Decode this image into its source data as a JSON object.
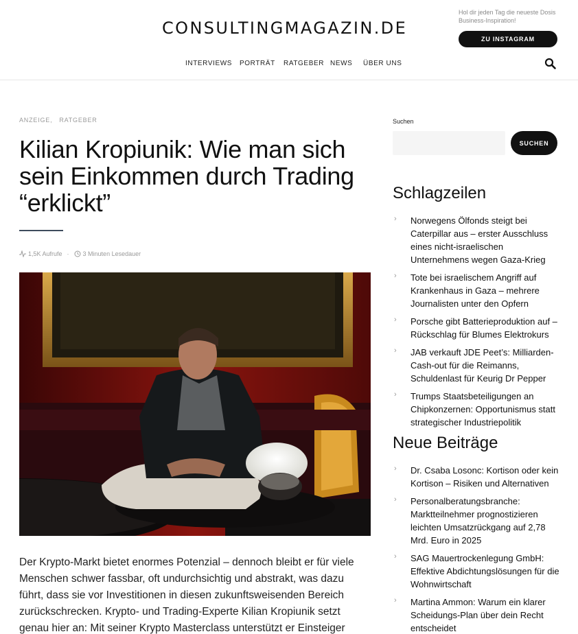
{
  "header": {
    "logo": "CONSULTINGMAGAZIN.DE",
    "promo_text": "Hol dir jeden Tag die neueste Dosis Business-Inspiration!",
    "instagram_button": "ZU INSTAGRAM"
  },
  "nav": {
    "items": [
      "INTERVIEWS",
      "PORTRÄT",
      "RATGEBER",
      "NEWS",
      "ÜBER UNS"
    ],
    "search_icon": "search-icon"
  },
  "article": {
    "categories": [
      "ANZEIGE,",
      "RATGEBER"
    ],
    "title": "Kilian Kropiunik: Wie man sich sein Einkommen durch Trading “erklickt”",
    "views": "1,5K Aufrufe",
    "separator": "·",
    "reading_time": "3 Minuten Lesedauer",
    "body": "Der Krypto-Markt bietet enormes Potenzial – dennoch bleibt er für viele Menschen schwer fassbar, oft undurchsichtig und abstrakt, was dazu führt, dass sie vor Investitionen in diesen zukunftsweisenden Bereich zurückschrecken. Krypto- und Trading-Experte Kilian Kropiunik setzt genau hier an: Mit seiner Krypto Masterclass unterstützt er Einsteiger"
  },
  "sidebar": {
    "search_label": "Suchen",
    "search_placeholder": "",
    "search_button": "SUCHEN",
    "headlines_title": "Schlagzeilen",
    "headlines": [
      "Norwegens Ölfonds steigt bei Caterpillar aus – erster Ausschluss eines nicht-israelischen Unternehmens wegen Gaza-Krieg",
      "Tote bei israelischem Angriff auf Krankenhaus in Gaza – mehrere Journalisten unter den Opfern",
      "Porsche gibt Batterieproduktion auf – Rückschlag für Blumes Elektrokurs",
      "JAB verkauft JDE Peet’s: Milliarden-Cash-out für die Reimanns, Schuldenlast für Keurig Dr Pepper",
      "Trumps Staatsbeteiligungen an Chipkonzernen: Opportunismus statt strategischer Industriepolitik"
    ],
    "recent_title": "Neue Beiträge",
    "recent": [
      "Dr. Csaba Losonc: Kortison oder kein Kortison – Risiken und Alternativen",
      "Personalberatungsbranche: Marktteilnehmer prognostizieren leichten Umsatzrückgang auf 2,78 Mrd. Euro in 2025",
      "SAG Mauertrockenlegung GmbH: Effektive Abdichtungslösungen für die Wohnwirtschaft",
      "Martina Ammon: Warum ein klarer Scheidungs-Plan über dein Recht entscheidet"
    ],
    "arrow": "›"
  }
}
